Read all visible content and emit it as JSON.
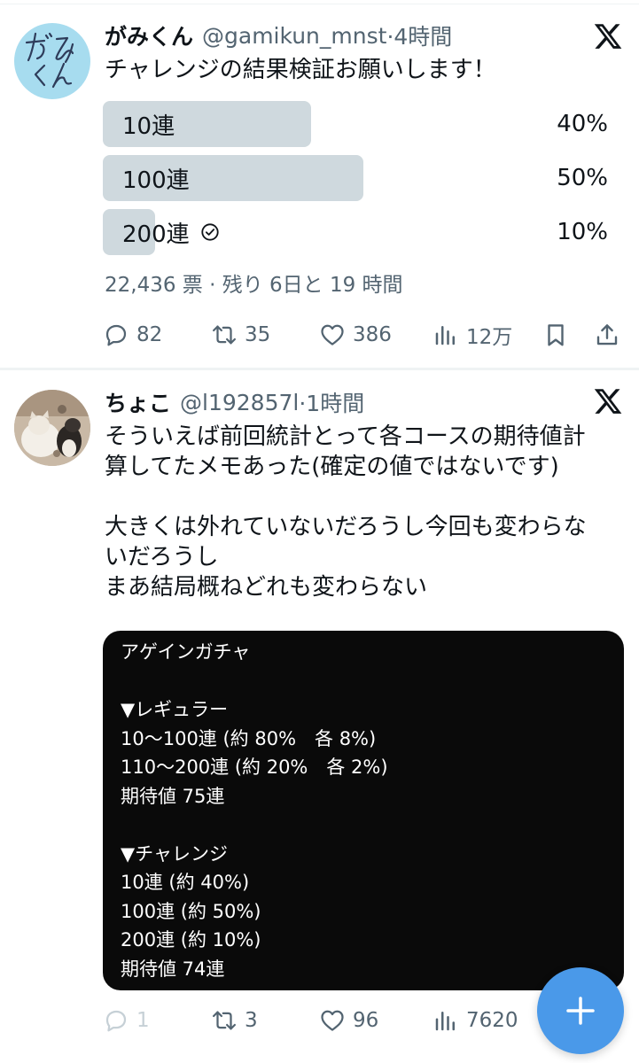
{
  "tweets": [
    {
      "name": "がみくん",
      "handle": "@gamikun_mnst",
      "time": "·4時間",
      "avatar_text": "がみくん",
      "text": "チャレンジの結果検証お願いします！",
      "poll": {
        "options": [
          {
            "label": "10連",
            "percent_text": "40%",
            "percent": 40,
            "winner": false
          },
          {
            "label": "100連",
            "percent_text": "50%",
            "percent": 50,
            "winner": false
          },
          {
            "label": "200連",
            "percent_text": "10%",
            "percent": 10,
            "winner": true
          }
        ],
        "meta": "22,436 票 · 残り 6日と 19 時間"
      },
      "actions": {
        "replies": "82",
        "retweets": "35",
        "likes": "386",
        "views": "12万"
      }
    },
    {
      "name": "ちょこ",
      "handle": "@l192857l",
      "time": "·1時間",
      "text": "そういえば前回統計とって各コースの期待値計\n算してたメモあった(確定の値ではないです)\n\n大きくは外れていないだろうし今回も変わらな\nいだろうし\nまあ結局概ねどれも変わらない",
      "image_text": "アゲインガチャ\n\n▼レギュラー\n10〜100連 (約 80%　各 8%)\n110〜200連 (約 20%　各 2%)\n期待値 75連\n\n▼チャレンジ\n10連 (約 40%)\n100連 (約 50%)\n200連 (約 10%)\n期待値 74連",
      "actions": {
        "replies": "1",
        "retweets": "3",
        "likes": "96",
        "views": "7620"
      }
    }
  ],
  "colors": {
    "accent": "#1d9bf0",
    "fab": "#4a99e9",
    "secondary_text": "#536471",
    "poll_bar": "#cfd9de",
    "divider": "#eff3f4"
  },
  "icons": [
    "x-logo-icon",
    "reply-icon",
    "retweet-icon",
    "like-icon",
    "views-icon",
    "bookmark-icon",
    "share-icon",
    "check-circle-icon",
    "compose-plus-icon"
  ]
}
